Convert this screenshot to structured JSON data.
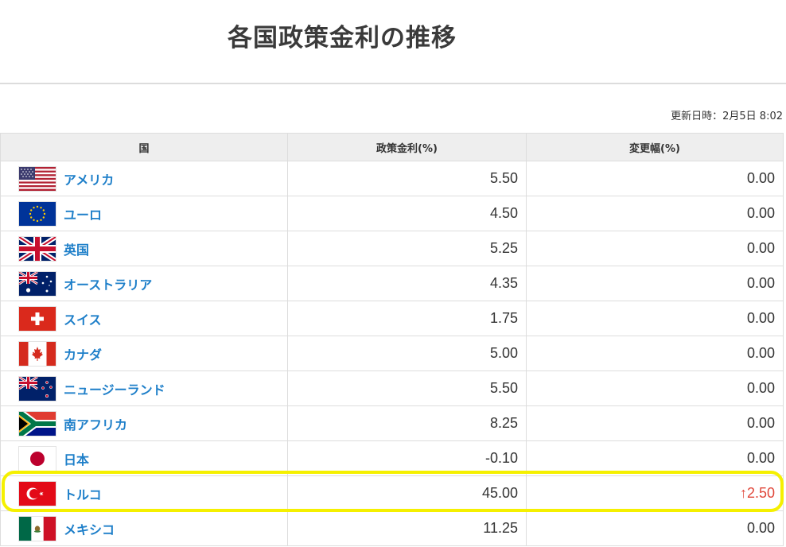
{
  "page": {
    "title": "各国政策金利の推移",
    "updated": "更新日時：2月5日 8:02"
  },
  "table": {
    "headers": [
      "国",
      "政策金利(%)",
      "変更幅(%)"
    ],
    "rows": [
      {
        "country": "アメリカ",
        "flag": "us-flag-icon",
        "rate": "5.50",
        "change": "0.00"
      },
      {
        "country": "ユーロ",
        "flag": "eu-flag-icon",
        "rate": "4.50",
        "change": "0.00"
      },
      {
        "country": "英国",
        "flag": "uk-flag-icon",
        "rate": "5.25",
        "change": "0.00"
      },
      {
        "country": "オーストラリア",
        "flag": "australia-flag-icon",
        "rate": "4.35",
        "change": "0.00"
      },
      {
        "country": "スイス",
        "flag": "switzerland-flag-icon",
        "rate": "1.75",
        "change": "0.00"
      },
      {
        "country": "カナダ",
        "flag": "canada-flag-icon",
        "rate": "5.00",
        "change": "0.00"
      },
      {
        "country": "ニュージーランド",
        "flag": "new-zealand-flag-icon",
        "rate": "5.50",
        "change": "0.00"
      },
      {
        "country": "南アフリカ",
        "flag": "south-africa-flag-icon",
        "rate": "8.25",
        "change": "0.00"
      },
      {
        "country": "日本",
        "flag": "japan-flag-icon",
        "rate": "-0.10",
        "change": "0.00"
      },
      {
        "country": "トルコ",
        "flag": "turkey-flag-icon",
        "rate": "45.00",
        "change": "2.50",
        "direction": "up",
        "arrow": "↑"
      },
      {
        "country": "メキシコ",
        "flag": "mexico-flag-icon",
        "rate": "11.25",
        "change": "0.00"
      }
    ]
  },
  "colors": {
    "link": "#1e7fc9",
    "up": "#e0473a",
    "highlight": "#f5f000",
    "header_bg": "#eeeeee"
  }
}
